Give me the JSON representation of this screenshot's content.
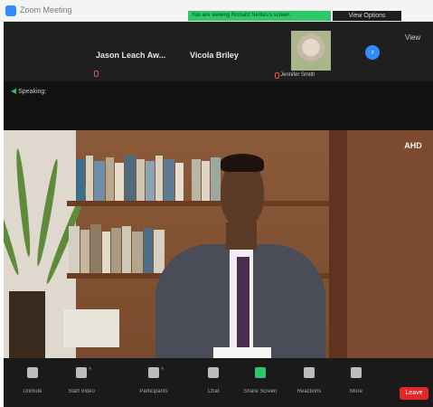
{
  "window": {
    "title": "Zoom Meeting",
    "share_banner": "You are viewing Richard Nettles's screen",
    "stop_share_label": "View Options"
  },
  "gallery": {
    "participants": [
      {
        "name": "Jason Leach Aw..."
      },
      {
        "name": "Vicola Briley"
      },
      {
        "name": "Jennifer Smith"
      }
    ],
    "next_page_label": "›",
    "view_label": "View"
  },
  "speaker": {
    "label": "Speaking:"
  },
  "video": {
    "logo_text": "AHD"
  },
  "toolbar": {
    "buttons": [
      {
        "label": "Unmute"
      },
      {
        "label": "Start Video"
      },
      {
        "label": "Participants"
      },
      {
        "label": "Chat"
      },
      {
        "label": "Share Screen"
      },
      {
        "label": "Reactions"
      },
      {
        "label": "More"
      }
    ],
    "end_label": "Leave"
  },
  "colors": {
    "accent_blue": "#2d8cff",
    "share_green": "#2ec866",
    "end_red": "#e02828"
  }
}
